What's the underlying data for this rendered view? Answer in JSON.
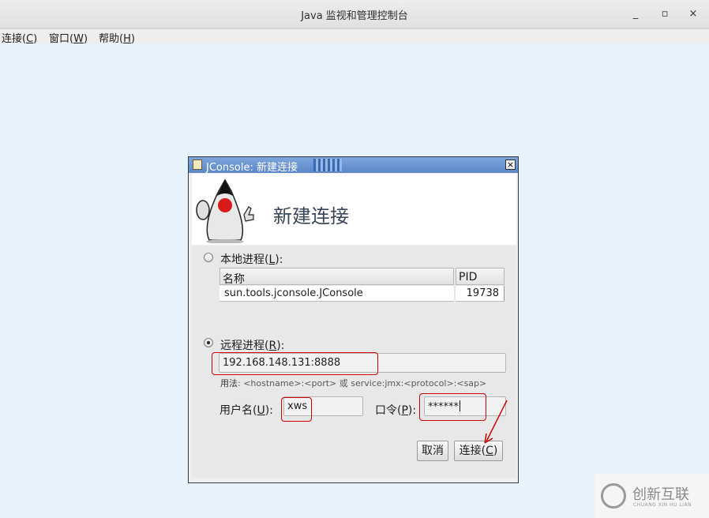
{
  "window": {
    "title": "Java 监视和管理控制台",
    "controls": {
      "minimize": "_",
      "maximize": "▫",
      "close": "×"
    }
  },
  "menu": [
    {
      "label": "连接(",
      "mnemonic": "C",
      "suffix": ")"
    },
    {
      "label": "窗口(",
      "mnemonic": "W",
      "suffix": ")"
    },
    {
      "label": "帮助(",
      "mnemonic": "H",
      "suffix": ")"
    }
  ],
  "dialog": {
    "title": "JConsole: 新建连接",
    "header_title": "新建连接",
    "local": {
      "label": "本地进程(",
      "mnemonic": "L",
      "suffix": "):",
      "selected": false,
      "columns": [
        "名称",
        "PID"
      ],
      "rows": [
        {
          "name": "sun.tools.jconsole.JConsole",
          "pid": "19738"
        }
      ]
    },
    "remote": {
      "label": "远程进程(",
      "mnemonic": "R",
      "suffix": "):",
      "selected": true,
      "address": "192.168.148.131:8888",
      "usage_label": "用法",
      "usage_text": ": <hostname>:<port> 或 service:jmx:<protocol>:<sap>"
    },
    "username": {
      "label": "用户名(",
      "mnemonic": "U",
      "suffix": "):",
      "value": "xws"
    },
    "password": {
      "label": "口令(",
      "mnemonic": "P",
      "suffix": "):",
      "value": "******"
    },
    "buttons": {
      "cancel": "取消",
      "connect": {
        "label": "连接(",
        "mnemonic": "C",
        "suffix": ")"
      }
    }
  },
  "watermark": {
    "text": "创新互联",
    "subtext": "CHUANG XIN HU LIAN"
  },
  "colors": {
    "annotation": "#d00000",
    "dialog_title": "#5b87c7",
    "desktop": "#e8f2fa"
  }
}
